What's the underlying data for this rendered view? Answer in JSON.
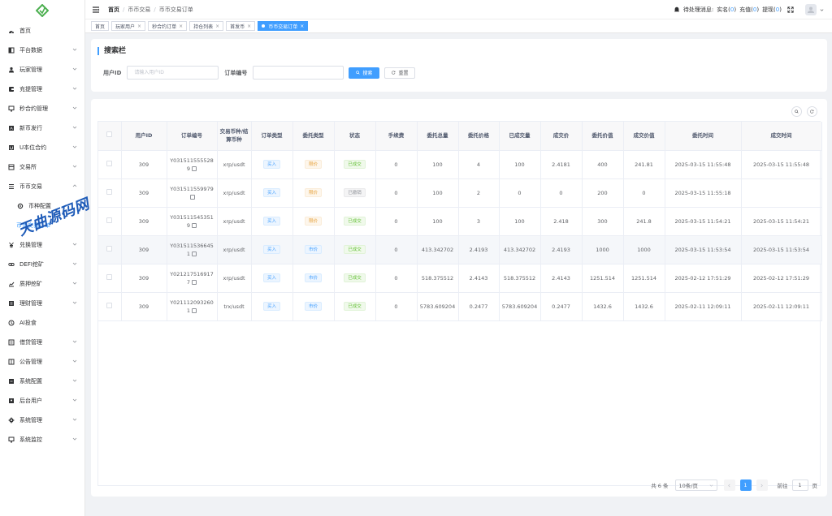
{
  "sidebar": {
    "items": [
      {
        "label": "首页",
        "icon": "dashboard-icon",
        "has_children": false
      },
      {
        "label": "平台数据",
        "icon": "data-icon",
        "has_children": true
      },
      {
        "label": "玩家管理",
        "icon": "user-icon",
        "has_children": true
      },
      {
        "label": "充提管理",
        "icon": "wallet-icon",
        "has_children": true
      },
      {
        "label": "秒合约管理",
        "icon": "contract-icon",
        "has_children": true
      },
      {
        "label": "新币发行",
        "icon": "coin-icon",
        "has_children": true
      },
      {
        "label": "U本位合约",
        "icon": "u-icon",
        "has_children": true
      },
      {
        "label": "交易所",
        "icon": "exchange-icon",
        "has_children": true
      },
      {
        "label": "币币交易",
        "icon": "list-icon",
        "has_children": true,
        "expanded": true
      },
      {
        "label": "币种配置",
        "icon": "gear-icon",
        "sub": true
      },
      {
        "label": "币币交易订单",
        "icon": "",
        "sub": true,
        "active": true
      },
      {
        "label": "兑换管理",
        "icon": "yen-icon",
        "has_children": true
      },
      {
        "label": "DEFI挖矿",
        "icon": "chain-icon",
        "has_children": true
      },
      {
        "label": "质押挖矿",
        "icon": "chart-icon",
        "has_children": true
      },
      {
        "label": "理财管理",
        "icon": "finance-icon",
        "has_children": true
      },
      {
        "label": "AI投食",
        "icon": "ai-icon",
        "has_children": false
      },
      {
        "label": "借贷管理",
        "icon": "loan-icon",
        "has_children": true
      },
      {
        "label": "公告管理",
        "icon": "notice-icon",
        "has_children": true
      },
      {
        "label": "系统配置",
        "icon": "config-icon",
        "has_children": true
      },
      {
        "label": "后台用户",
        "icon": "admin-icon",
        "has_children": true
      },
      {
        "label": "系统管理",
        "icon": "settings-icon",
        "has_children": true
      },
      {
        "label": "系统监控",
        "icon": "monitor-icon",
        "has_children": true
      }
    ]
  },
  "header": {
    "breadcrumb": [
      "首页",
      "币币交易",
      "币币交易订单"
    ],
    "pending_label": "待处理消息:",
    "realname_label": "实名(",
    "realname_count": "0",
    "recharge_label": "充值(",
    "recharge_count": "0",
    "withdraw_label": "提现(",
    "withdraw_count": "0",
    "close_paren": ")"
  },
  "tabs": [
    {
      "label": "首页",
      "closable": false
    },
    {
      "label": "玩家用户",
      "closable": true
    },
    {
      "label": "秒合约订单",
      "closable": true
    },
    {
      "label": "持仓列表",
      "closable": true
    },
    {
      "label": "首发币",
      "closable": true
    },
    {
      "label": "币币交易订单",
      "closable": true,
      "active": true
    }
  ],
  "search": {
    "title": "搜索栏",
    "user_id_label": "用户ID",
    "user_id_placeholder": "请输入用户ID",
    "order_no_label": "订单编号",
    "order_no_value": "",
    "search_button": "搜索",
    "reset_button": "重置"
  },
  "table": {
    "columns": [
      "用户ID",
      "订单编号",
      "交易币种/结算币种",
      "订单类型",
      "委托类型",
      "状态",
      "手续费",
      "委托总量",
      "委托价格",
      "已成交量",
      "成交价",
      "委托价值",
      "成交价值",
      "委托时间",
      "成交时间"
    ],
    "rows": [
      {
        "user_id": "309",
        "order_no": "Y0315115555289",
        "pair": "xrp/usdt",
        "order_type": "买入",
        "entrust_type": "限价",
        "status": "已成交",
        "fee": "0",
        "total": "100",
        "price": "4",
        "filled": "100",
        "deal_price": "2.4181",
        "entrust_value": "400",
        "deal_value": "241.81",
        "entrust_time": "2025-03-15 11:55:48",
        "deal_time": "2025-03-15 11:55:48",
        "highlight": false
      },
      {
        "user_id": "309",
        "order_no": "Y031511559979",
        "pair": "xrp/usdt",
        "order_type": "买入",
        "entrust_type": "限价",
        "status": "已撤销",
        "fee": "0",
        "total": "100",
        "price": "2",
        "filled": "0",
        "deal_price": "0",
        "entrust_value": "200",
        "deal_value": "0",
        "entrust_time": "2025-03-15 11:55:18",
        "deal_time": "",
        "highlight": false
      },
      {
        "user_id": "309",
        "order_no": "Y0315115453519",
        "pair": "xrp/usdt",
        "order_type": "买入",
        "entrust_type": "限价",
        "status": "已成交",
        "fee": "0",
        "total": "100",
        "price": "3",
        "filled": "100",
        "deal_price": "2.418",
        "entrust_value": "300",
        "deal_value": "241.8",
        "entrust_time": "2025-03-15 11:54:21",
        "deal_time": "2025-03-15 11:54:21",
        "highlight": false
      },
      {
        "user_id": "309",
        "order_no": "Y0315115366451",
        "pair": "xrp/usdt",
        "order_type": "买入",
        "entrust_type": "市价",
        "status": "已成交",
        "fee": "0",
        "total": "413.342702",
        "price": "2.4193",
        "filled": "413.342702",
        "deal_price": "2.4193",
        "entrust_value": "1000",
        "deal_value": "1000",
        "entrust_time": "2025-03-15 11:53:54",
        "deal_time": "2025-03-15 11:53:54",
        "highlight": true
      },
      {
        "user_id": "309",
        "order_no": "Y0212175169177",
        "pair": "xrp/usdt",
        "order_type": "买入",
        "entrust_type": "市价",
        "status": "已成交",
        "fee": "0",
        "total": "518.375512",
        "price": "2.4143",
        "filled": "518.375512",
        "deal_price": "2.4143",
        "entrust_value": "1251.514",
        "deal_value": "1251.514",
        "entrust_time": "2025-02-12 17:51:29",
        "deal_time": "2025-02-12 17:51:29",
        "highlight": false
      },
      {
        "user_id": "309",
        "order_no": "Y0211120932601",
        "pair": "trx/usdt",
        "order_type": "买入",
        "entrust_type": "市价",
        "status": "已成交",
        "fee": "0",
        "total": "5783.609204",
        "price": "0.2477",
        "filled": "5783.609204",
        "deal_price": "0.2477",
        "entrust_value": "1432.6",
        "deal_value": "1432.6",
        "entrust_time": "2025-02-11 12:09:11",
        "deal_time": "2025-02-11 12:09:11",
        "highlight": false
      }
    ]
  },
  "pagination": {
    "total_text": "共 6 条",
    "page_size": "10条/页",
    "current_page": "1",
    "goto_label": "前往",
    "goto_value": "1",
    "page_unit": "页"
  },
  "watermark": "天曲源码网 tqym.cc",
  "colors": {
    "accent": "#409eff",
    "success": "#67c23a",
    "warning": "#e6a23c"
  }
}
